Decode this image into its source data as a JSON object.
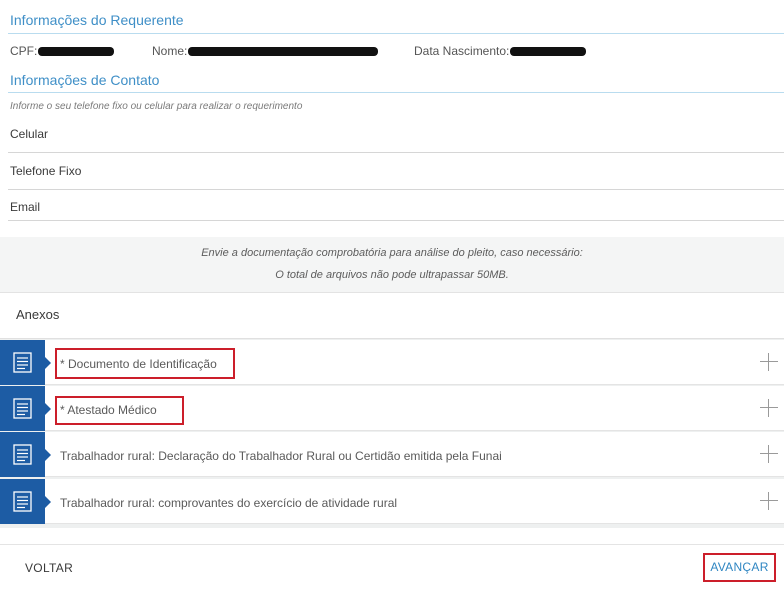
{
  "requerente": {
    "title": "Informações do Requerente",
    "cpf_label": "CPF:",
    "nome_label": "Nome:",
    "nascimento_label": "Data Nascimento:"
  },
  "contato": {
    "title": "Informações de Contato",
    "hint": "Informe o seu telefone fixo ou celular para realizar o requerimento",
    "fields": [
      {
        "label": "Celular"
      },
      {
        "label": "Telefone Fixo"
      },
      {
        "label": "Email"
      }
    ]
  },
  "notice": {
    "line1": "Envie a documentação comprobatória para análise do pleito, caso necessário:",
    "line2": "O total de arquivos não pode ultrapassar 50MB."
  },
  "anexos": {
    "title": "Anexos",
    "items": [
      {
        "label": "* Documento de Identificação",
        "icon": "document-icon"
      },
      {
        "label": "* Atestado Médico",
        "icon": "document-icon"
      },
      {
        "label": "Trabalhador rural: Declaração do Trabalhador Rural ou Certidão emitida pela Funai",
        "icon": "document-icon"
      },
      {
        "label": "Trabalhador rural: comprovantes do exercício de atividade rural",
        "icon": "document-icon"
      }
    ]
  },
  "footer": {
    "voltar_label": "VOLTAR",
    "avancar_label": "AVANÇAR"
  },
  "colors": {
    "accent": "#3f8fc7",
    "icon_bg": "#1d5ca4",
    "highlight": "#cc1e2a"
  }
}
